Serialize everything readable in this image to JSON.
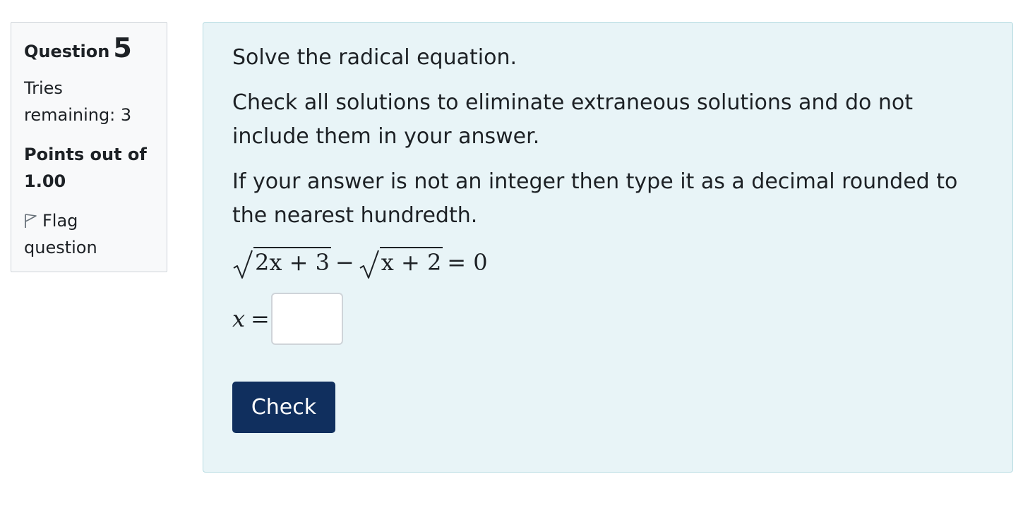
{
  "info": {
    "question_label": "Question",
    "question_number": "5",
    "tries_line1": "Tries",
    "tries_line2": "remaining: 3",
    "points_line1": "Points out of",
    "points_line2": "1.00",
    "flag_line1": "Flag",
    "flag_line2": "question",
    "flag_icon": "flag-icon"
  },
  "question": {
    "prompt": "Solve the radical equation.",
    "instruction": "Check all solutions to eliminate extraneous solutions and do not include them in your answer.",
    "rounding_note": "If your answer is not an integer then type it as a decimal rounded to the nearest hundredth.",
    "equation": {
      "radicand1": "2x + 3",
      "minus": "−",
      "radicand2": "x + 2",
      "rhs": "= 0"
    },
    "answer_variable": "x",
    "answer_equals": "=",
    "answer_value": "",
    "check_label": "Check"
  },
  "colors": {
    "content_bg": "#e8f4f7",
    "button_bg": "#102f5e",
    "info_bg": "#f8f9fa"
  }
}
